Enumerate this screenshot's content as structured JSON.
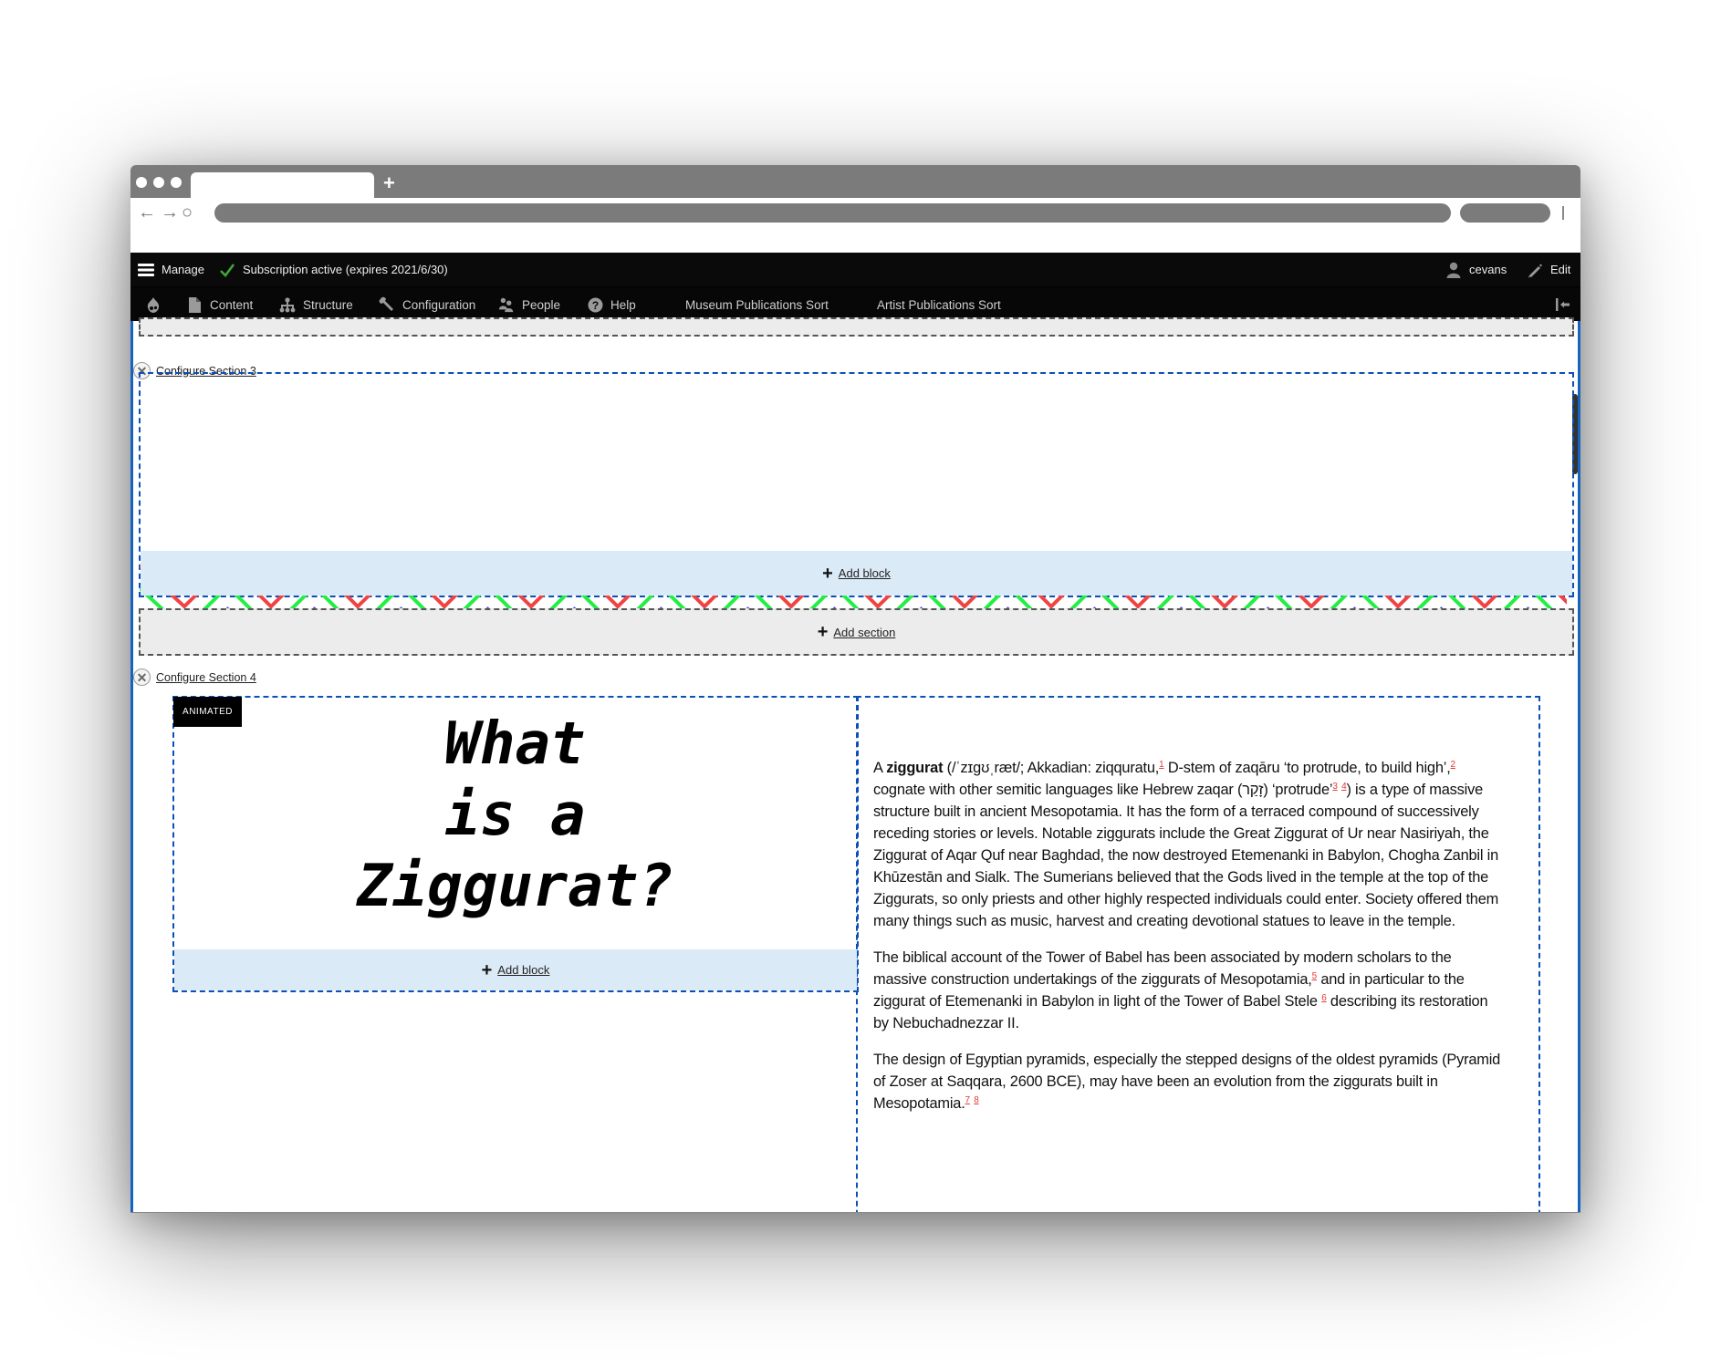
{
  "browser": {
    "new_tab_label": "+",
    "nav": {
      "back": "←",
      "forward": "→",
      "reload": "○"
    }
  },
  "toolbar": {
    "manage_label": "Manage",
    "subscription_status": "Subscription active (expires 2021/6/30)",
    "user_label": "cevans",
    "edit_label": "Edit",
    "menu": [
      {
        "label": "Content",
        "icon": "document-icon"
      },
      {
        "label": "Structure",
        "icon": "structure-icon"
      },
      {
        "label": "Configuration",
        "icon": "wrench-icon"
      },
      {
        "label": "People",
        "icon": "people-icon"
      },
      {
        "label": "Help",
        "icon": "help-icon"
      },
      {
        "label": "Museum Publications Sort"
      },
      {
        "label": "Artist Publications Sort"
      }
    ],
    "colors": {
      "check": "#3fa535",
      "background": "#0a0a0a"
    }
  },
  "layout_builder": {
    "section3": {
      "configure_label": "Configure Section 3",
      "add_block_label": "Add block",
      "zigzag_colors": [
        "#ef4444",
        "#22ee44",
        "#4f46e5"
      ]
    },
    "add_section_label": "Add section",
    "section4": {
      "configure_label": "Configure Section 4",
      "badge_label": "ANIMATED",
      "heading_lines": [
        "What",
        "is a",
        "Ziggurat?"
      ],
      "add_block_label": "Add block",
      "paragraphs": {
        "p1": {
          "a": "A ",
          "bold": "ziggurat",
          "b": " (/ˈzɪɡʊˌræt/; Akkadian: ziqquratu,",
          "fn1": "1",
          "c": " D-stem of zaqāru ‘to protrude, to build high’,",
          "fn2": "2",
          "d": " cognate with other semitic languages like Hebrew zaqar (זָקַר) ‘protrude’",
          "fn3": "3",
          "fn4": "4",
          "e": ") is a type of massive structure built in ancient Mesopotamia. It has the form of a terraced compound of successively receding stories or levels. Notable ziggurats include the Great Ziggurat of Ur near Nasiriyah, the Ziggurat of Aqar Quf near Baghdad, the now destroyed Etemenanki in Babylon, Chogha Zanbil in Khūzestān and Sialk. The Sumerians believed that the Gods lived in the temple at the top of the Ziggurats, so only priests and other highly respected individuals could enter. Society offered them many things such as music, harvest and creating devotional statues to leave in the temple."
        },
        "p2": {
          "a": "The biblical account of the Tower of Babel has been associated by modern scholars to the massive construction undertakings of the ziggurats of Mesopotamia,",
          "fn5": "5",
          "b": " and in particular to the ziggurat of Etemenanki in Babylon in light of the Tower of Babel Stele ",
          "fn6": "6",
          "c": " describing its restoration by Nebuchadnezzar II."
        },
        "p3": {
          "a": "The design of Egyptian pyramids, especially the stepped designs of the oldest pyramids (Pyramid of Zoser at Saqqara, 2600 BCE), may have been an evolution from the ziggurats built in Mesopotamia.",
          "fn7": "7",
          "fn8": "8"
        }
      },
      "accent_color": "#ef4444"
    }
  }
}
